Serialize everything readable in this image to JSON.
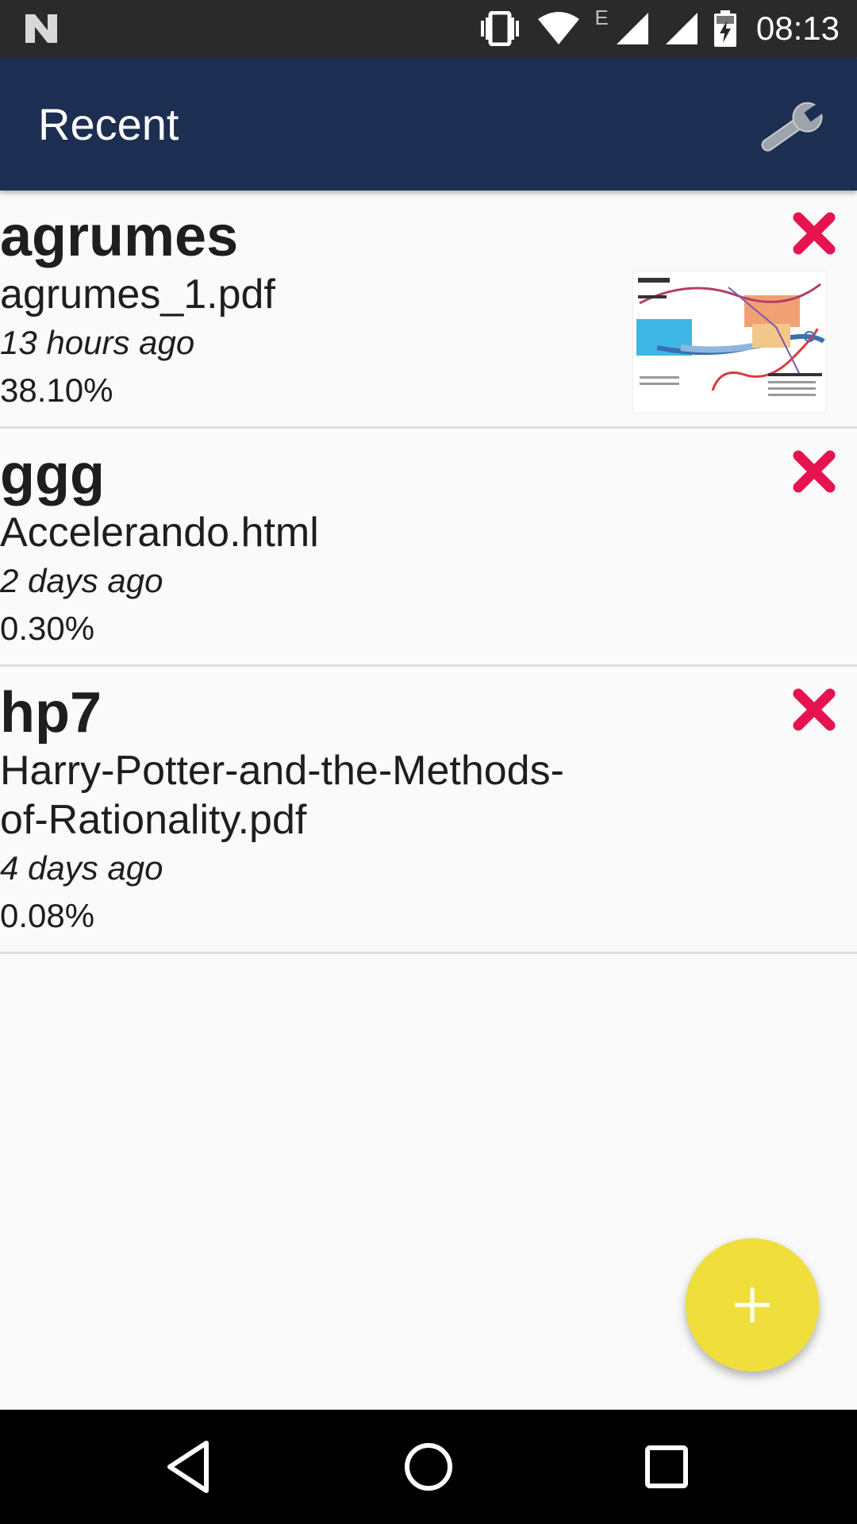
{
  "status_bar": {
    "time": "08:13",
    "network_label": "E",
    "icons": [
      "n-logo-icon",
      "vibrate-icon",
      "wifi-icon",
      "signal-icon",
      "signal-icon",
      "battery-charging-icon"
    ]
  },
  "app_bar": {
    "title": "Recent",
    "settings_icon": "wrench-icon"
  },
  "recent_items": [
    {
      "name": "agrumes",
      "file": "agrumes_1.pdf",
      "time": "13 hours ago",
      "progress": "38.10%",
      "progress_value": 0.381,
      "has_thumbnail": true
    },
    {
      "name": "ggg",
      "file": "Accelerando.html",
      "time": "2 days ago",
      "progress": "0.30%",
      "progress_value": 0.003,
      "has_thumbnail": false
    },
    {
      "name": "hp7",
      "file": "Harry-Potter-and-the-Methods-of-Rationality.pdf",
      "time": "4 days ago",
      "progress": "0.08%",
      "progress_value": 0.0008,
      "has_thumbnail": false
    }
  ],
  "fab": {
    "icon": "plus-icon"
  },
  "nav_bar": {
    "icons": [
      "back-icon",
      "home-icon",
      "recents-icon"
    ]
  },
  "colors": {
    "app_bar": "#1c2f52",
    "status_bar": "#2a2a2a",
    "delete": "#e5134f",
    "fab": "#f0de3c",
    "background": "#fafafa"
  }
}
